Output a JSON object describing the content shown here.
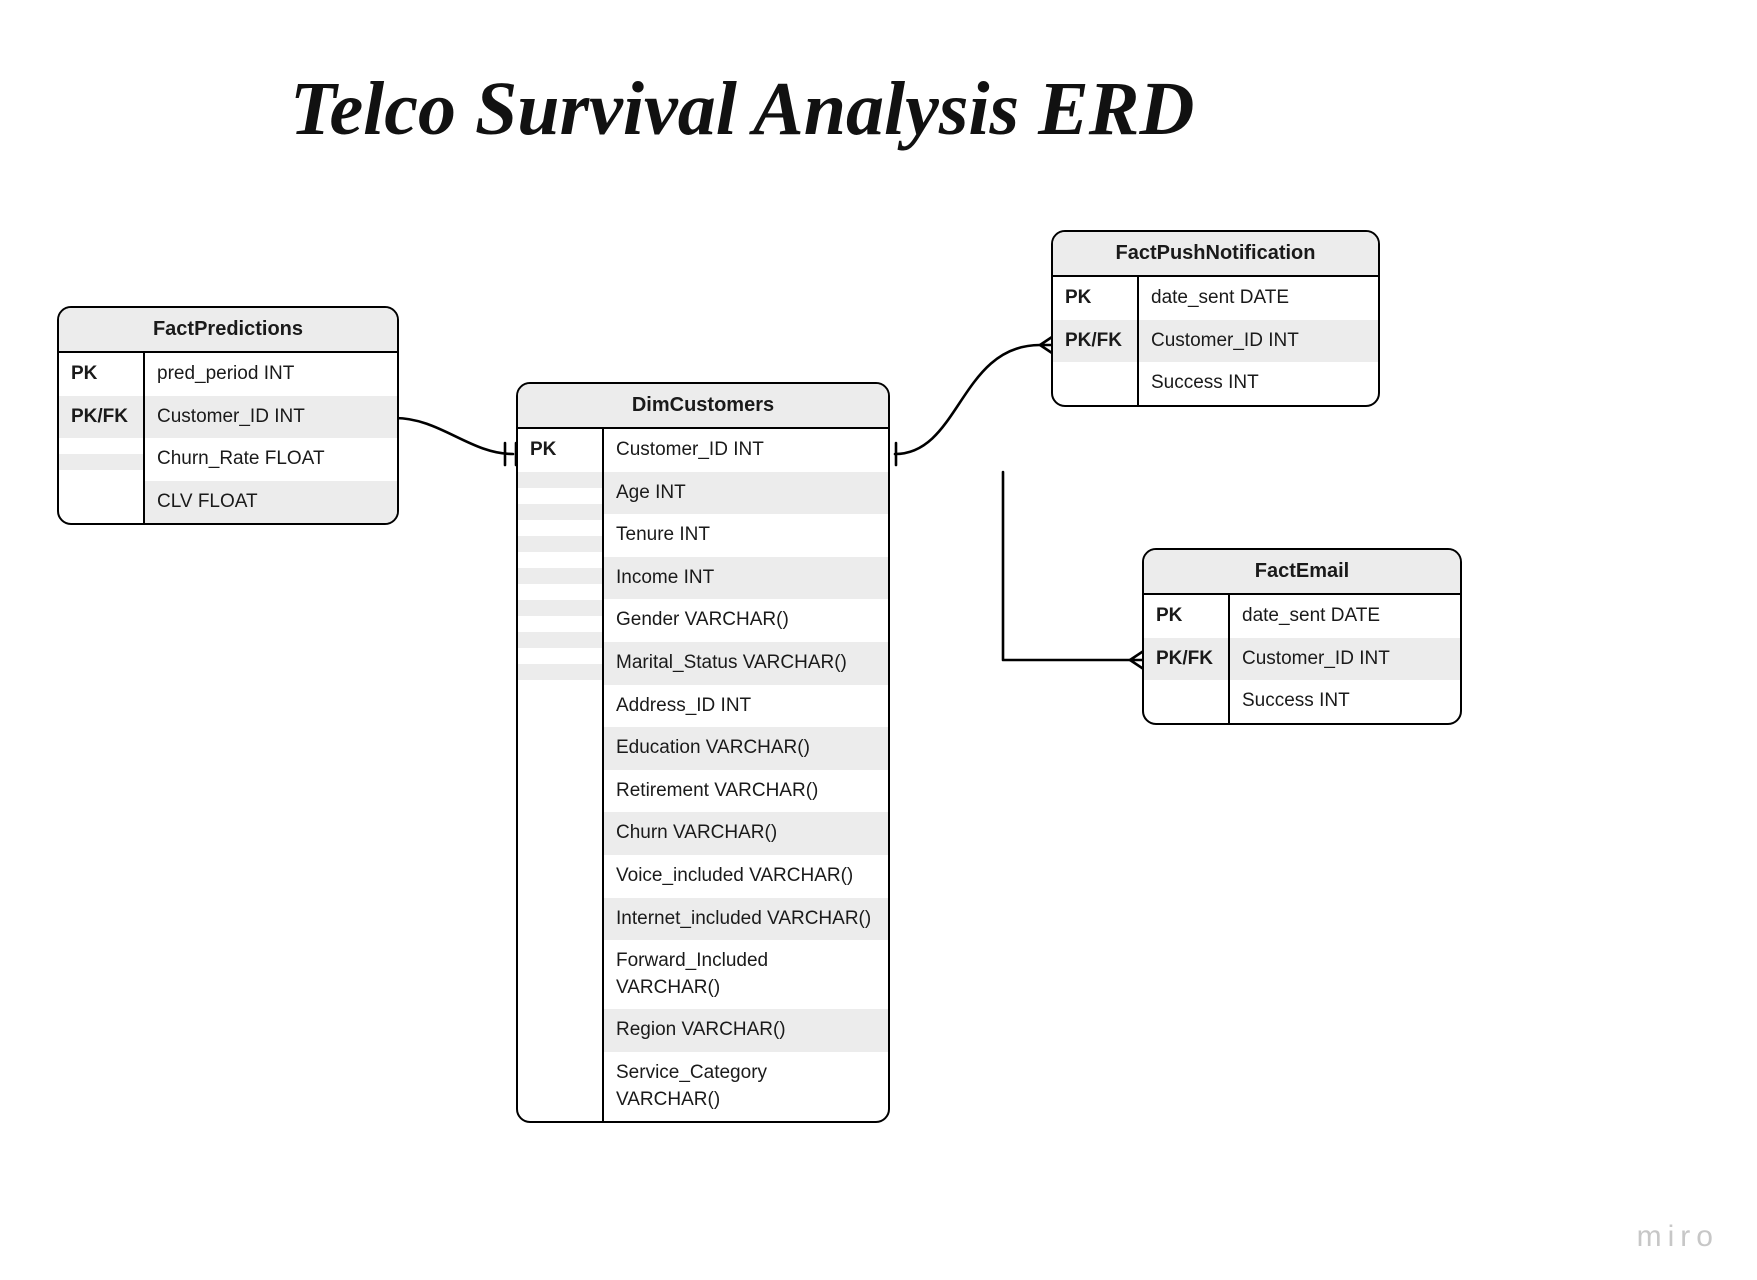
{
  "title": "Telco Survival Analysis ERD",
  "watermark": "miro",
  "entities": {
    "factPredictions": {
      "name": "FactPredictions",
      "rows": [
        {
          "key": "PK",
          "attr": "pred_period INT"
        },
        {
          "key": "PK/FK",
          "attr": "Customer_ID INT"
        },
        {
          "key": "",
          "attr": "Churn_Rate FLOAT"
        },
        {
          "key": "",
          "attr": "CLV FLOAT"
        }
      ]
    },
    "dimCustomers": {
      "name": "DimCustomers",
      "rows": [
        {
          "key": "PK",
          "attr": "Customer_ID INT"
        },
        {
          "key": "",
          "attr": "Age INT"
        },
        {
          "key": "",
          "attr": "Tenure INT"
        },
        {
          "key": "",
          "attr": "Income INT"
        },
        {
          "key": "",
          "attr": "Gender VARCHAR()"
        },
        {
          "key": "",
          "attr": "Marital_Status VARCHAR()"
        },
        {
          "key": "",
          "attr": "Address_ID INT"
        },
        {
          "key": "",
          "attr": "Education VARCHAR()"
        },
        {
          "key": "",
          "attr": "Retirement VARCHAR()"
        },
        {
          "key": "",
          "attr": "Churn VARCHAR()"
        },
        {
          "key": "",
          "attr": "Voice_included VARCHAR()"
        },
        {
          "key": "",
          "attr": "Internet_included VARCHAR()"
        },
        {
          "key": "",
          "attr": "Forward_Included VARCHAR()"
        },
        {
          "key": "",
          "attr": "Region VARCHAR()"
        },
        {
          "key": "",
          "attr": "Service_Category VARCHAR()"
        }
      ]
    },
    "factPushNotification": {
      "name": "FactPushNotification",
      "rows": [
        {
          "key": "PK",
          "attr": "date_sent DATE"
        },
        {
          "key": "PK/FK",
          "attr": "Customer_ID INT"
        },
        {
          "key": "",
          "attr": "Success INT"
        }
      ]
    },
    "factEmail": {
      "name": "FactEmail",
      "rows": [
        {
          "key": "PK",
          "attr": "date_sent DATE"
        },
        {
          "key": "PK/FK",
          "attr": "Customer_ID INT"
        },
        {
          "key": "",
          "attr": "Success INT"
        }
      ]
    }
  }
}
